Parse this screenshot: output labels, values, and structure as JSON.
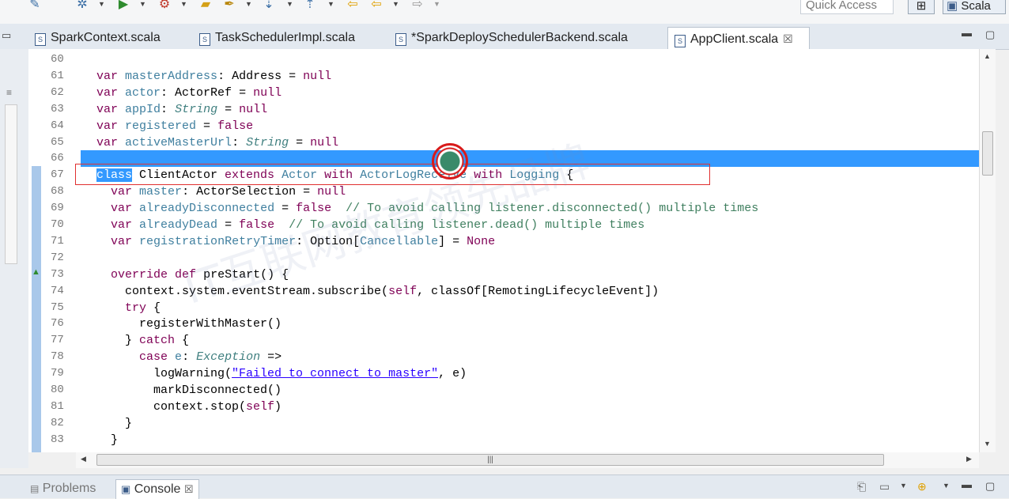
{
  "toolbar": {
    "quick_access_placeholder": "Quick Access",
    "perspective_label": "Scala",
    "icons": [
      "debug-icon",
      "run-icon",
      "external-tools-icon",
      "open-folder-icon",
      "search-icon",
      "next-annotation-icon",
      "prev-annotation-icon",
      "back-icon",
      "forward-icon"
    ]
  },
  "tabs": [
    {
      "label": "SparkContext.scala",
      "active": false
    },
    {
      "label": "TaskSchedulerImpl.scala",
      "active": false
    },
    {
      "label": "*SparkDeploySchedulerBackend.scala",
      "active": false
    },
    {
      "label": "AppClient.scala",
      "active": true
    }
  ],
  "editor": {
    "lines": [
      {
        "n": "60",
        "html": ""
      },
      {
        "n": "61",
        "html": "<span class='kw'>var</span> <span class='tr'>masterAddress</span>: Address = <span class='kw'>null</span>"
      },
      {
        "n": "62",
        "html": "<span class='kw'>var</span> <span class='tr'>actor</span>: ActorRef = <span class='kw'>null</span>"
      },
      {
        "n": "63",
        "html": "<span class='kw'>var</span> <span class='tr'>appId</span>: <span class='ty'>String</span> = <span class='kw'>null</span>"
      },
      {
        "n": "64",
        "html": "<span class='kw'>var</span> <span class='tr'>registered</span> = <span class='kw'>false</span>"
      },
      {
        "n": "65",
        "html": "<span class='kw'>var</span> <span class='tr'>activeMasterUrl</span>: <span class='ty'>String</span> = <span class='kw'>null</span>"
      },
      {
        "n": "66",
        "html": ""
      },
      {
        "n": "67",
        "html": "<span class='sel'>class</span> ClientActor <span class='kw'>extends</span> <span class='tr'>Actor</span> <span class='kw'>with</span> <span class='tr'>ActorLogReceive</span> <span class='kw'>with</span> <span class='tr'>Logging</span> {"
      },
      {
        "n": "68",
        "html": "  <span class='kw'>var</span> <span class='tr'>master</span>: ActorSelection = <span class='kw'>null</span>"
      },
      {
        "n": "69",
        "html": "  <span class='kw'>var</span> <span class='tr'>alreadyDisconnected</span> = <span class='kw'>false</span>  <span class='cm'>// To avoid calling listener.disconnected() multiple times</span>"
      },
      {
        "n": "70",
        "html": "  <span class='kw'>var</span> <span class='tr'>alreadyDead</span> = <span class='kw'>false</span>  <span class='cm'>// To avoid calling listener.dead() multiple times</span>"
      },
      {
        "n": "71",
        "html": "  <span class='kw'>var</span> <span class='tr'>registrationRetryTimer</span>: Option[<span class='tr'>Cancellable</span>] = <span class='kw'>None</span>"
      },
      {
        "n": "72",
        "html": ""
      },
      {
        "n": "73",
        "html": "  <span class='kw'>override</span> <span class='kw'>def</span> preStart() {"
      },
      {
        "n": "74",
        "html": "    context.system.eventStream.subscribe(<span class='kw'>self</span>, classOf[RemotingLifecycleEvent])"
      },
      {
        "n": "75",
        "html": "    <span class='kw'>try</span> {"
      },
      {
        "n": "76",
        "html": "      registerWithMaster()"
      },
      {
        "n": "77",
        "html": "    } <span class='kw'>catch</span> {"
      },
      {
        "n": "78",
        "html": "      <span class='kw'>case</span> <span class='tr'>e</span>: <span class='ty'>Exception</span> =>"
      },
      {
        "n": "79",
        "html": "        logWarning(<span class='st'>\"Failed to connect to master\"</span>, e)"
      },
      {
        "n": "80",
        "html": "        markDisconnected()"
      },
      {
        "n": "81",
        "html": "        context.stop(<span class='kw'>self</span>)"
      },
      {
        "n": "82",
        "html": "    }"
      },
      {
        "n": "83",
        "html": "  }"
      }
    ]
  },
  "bottom": {
    "tabs": [
      {
        "label": "Problems",
        "active": false
      },
      {
        "label": "Console",
        "active": true
      }
    ]
  },
  "watermark": "IT互联网教育领先品牌"
}
